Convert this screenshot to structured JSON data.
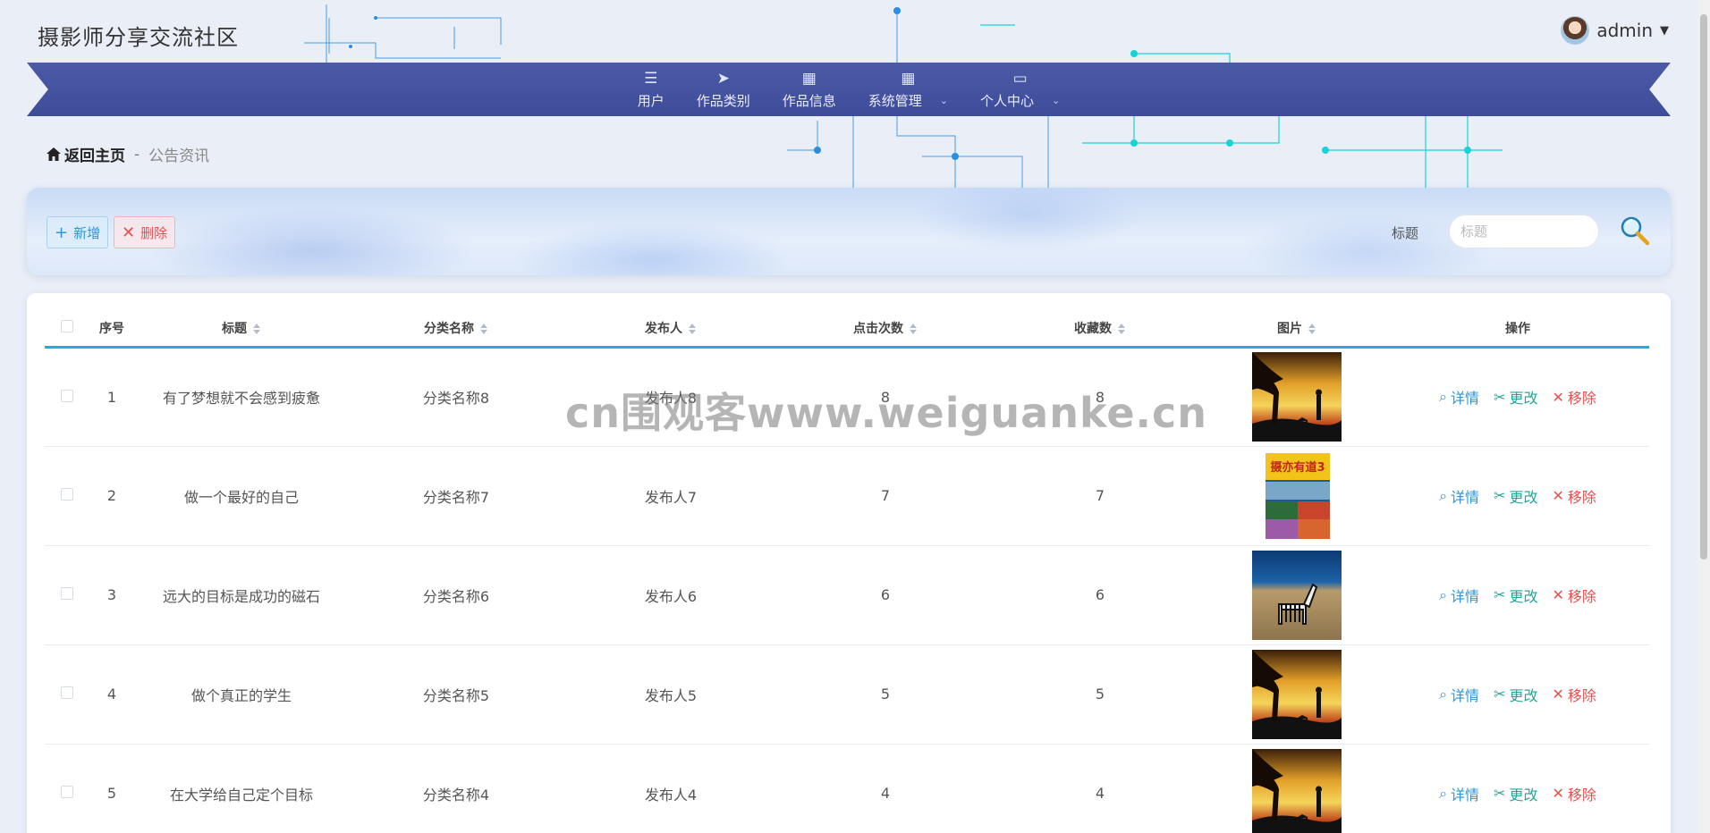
{
  "site": {
    "title": "摄影师分享交流社区"
  },
  "user": {
    "name": "admin"
  },
  "nav": {
    "items": [
      {
        "label": "用户",
        "icon": "list-icon"
      },
      {
        "label": "作品类别",
        "icon": "paper-plane-icon"
      },
      {
        "label": "作品信息",
        "icon": "grid-icon"
      },
      {
        "label": "系统管理",
        "icon": "grid-icon",
        "dropdown": true
      },
      {
        "label": "个人中心",
        "icon": "wallet-icon",
        "dropdown": true
      }
    ]
  },
  "breadcrumb": {
    "home": "返回主页",
    "separator": "-",
    "current": "公告资讯"
  },
  "toolbar": {
    "add_label": "新增",
    "delete_label": "删除"
  },
  "search": {
    "label": "标题",
    "placeholder": "标题",
    "value": ""
  },
  "table": {
    "headers": [
      "序号",
      "标题",
      "分类名称",
      "发布人",
      "点击次数",
      "收藏数",
      "图片",
      "操作"
    ],
    "rows": [
      {
        "index": "1",
        "title": "有了梦想就不会感到疲惫",
        "category": "分类名称8",
        "publisher": "发布人8",
        "clicks": "8",
        "favorites": "8",
        "image": "sunset-silhouette"
      },
      {
        "index": "2",
        "title": "做一个最好的自己",
        "category": "分类名称7",
        "publisher": "发布人7",
        "clicks": "7",
        "favorites": "7",
        "image": "book-cover"
      },
      {
        "index": "3",
        "title": "远大的目标是成功的磁石",
        "category": "分类名称6",
        "publisher": "发布人6",
        "clicks": "6",
        "favorites": "6",
        "image": "zebra"
      },
      {
        "index": "4",
        "title": "做个真正的学生",
        "category": "分类名称5",
        "publisher": "发布人5",
        "clicks": "5",
        "favorites": "5",
        "image": "sunset-silhouette"
      },
      {
        "index": "5",
        "title": "在大学给自己定个目标",
        "category": "分类名称4",
        "publisher": "发布人4",
        "clicks": "4",
        "favorites": "4",
        "image": "sunset-silhouette"
      }
    ],
    "actions": {
      "detail": "详情",
      "edit": "更改",
      "remove": "移除"
    }
  },
  "watermark": "cn围观客www.weiguanke.cn",
  "colors": {
    "nav": "#3e4c9a",
    "accent": "#27a9e1",
    "detail": "#2e95d6",
    "edit": "#21a79a",
    "remove": "#e8504e"
  }
}
